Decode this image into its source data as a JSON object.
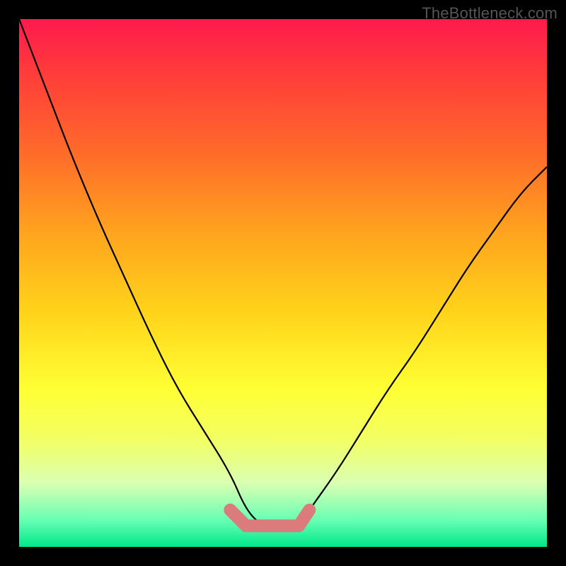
{
  "watermark": "TheBottleneck.com",
  "chart_data": {
    "type": "line",
    "title": "",
    "xlabel": "",
    "ylabel": "",
    "xlim": [
      0,
      100
    ],
    "ylim": [
      0,
      100
    ],
    "series": [
      {
        "name": "bottleneck-curve",
        "x": [
          0,
          5,
          10,
          15,
          20,
          25,
          30,
          35,
          40,
          43,
          46,
          50,
          53,
          55,
          60,
          65,
          70,
          75,
          80,
          85,
          90,
          95,
          100
        ],
        "values": [
          100,
          87,
          74,
          62,
          51,
          40,
          30,
          22,
          14,
          7,
          4,
          4,
          4,
          7,
          14,
          22,
          30,
          37,
          45,
          53,
          60,
          67,
          72
        ]
      }
    ],
    "highlight": {
      "color": "#db7b7b",
      "x": [
        40,
        43,
        46,
        50,
        53,
        55
      ],
      "values": [
        7,
        4,
        4,
        4,
        4,
        7
      ]
    },
    "gradient_stops": [
      {
        "pos": 0,
        "color": "#ff1a4d"
      },
      {
        "pos": 25,
        "color": "#ff6a2a"
      },
      {
        "pos": 55,
        "color": "#ffd21a"
      },
      {
        "pos": 80,
        "color": "#f2ff66"
      },
      {
        "pos": 100,
        "color": "#00e68a"
      }
    ]
  }
}
